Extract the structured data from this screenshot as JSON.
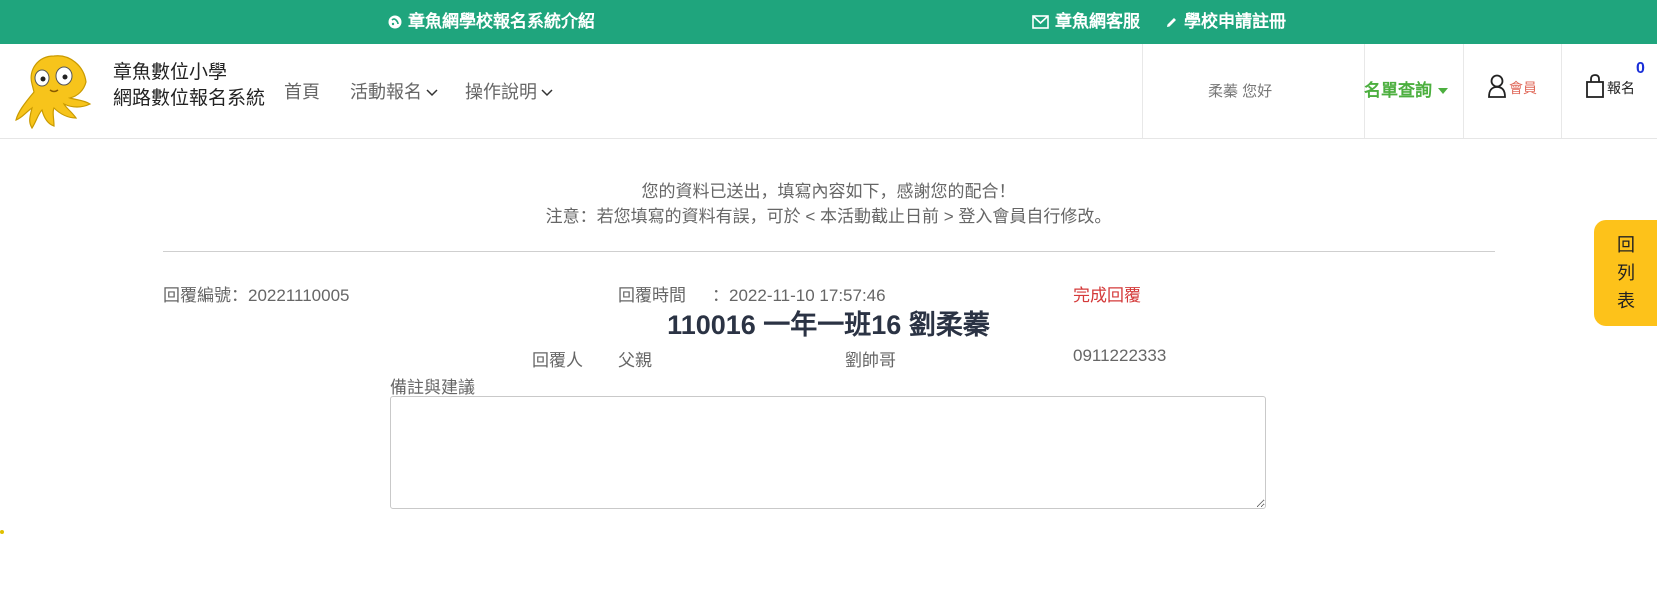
{
  "topbar": {
    "intro_link": "章魚網學校報名系統介紹",
    "service_link": "章魚網客服",
    "register_link": "學校申請註冊"
  },
  "header": {
    "brand_line1": "章魚數位小學",
    "brand_line2": "網路數位報名系統",
    "nav": {
      "home": "首頁",
      "activity": "活動報名",
      "guide": "操作說明"
    },
    "greeting": "柔蓁 您好",
    "query": "名單查詢",
    "member": "會員",
    "cart_label": "報名",
    "cart_count": "0"
  },
  "notice": {
    "line1": "您的資料已送出，填寫內容如下，感謝您的配合！",
    "line2": "注意：若您填寫的資料有誤，可於 < 本活動截止日前 > 登入會員自行修改。"
  },
  "reply": {
    "number": "回覆編號：20221110005",
    "time_label": "回覆時間",
    "time_value": "：2022-11-10 17:57:46",
    "status": "完成回覆",
    "student": "110016 一年一班16 劉柔蓁",
    "replier_label": "回覆人",
    "relation": "父親",
    "name": "劉帥哥",
    "phone": "0911222333",
    "remarks_label": "備註與建議",
    "remarks_value": ""
  },
  "side_button": {
    "char1": "回",
    "char2": "列",
    "char3": "表"
  },
  "colors": {
    "topbar": "#1fa57d",
    "query": "#4caf3f",
    "status": "#d43a3a",
    "side_button": "#fdc21a"
  }
}
